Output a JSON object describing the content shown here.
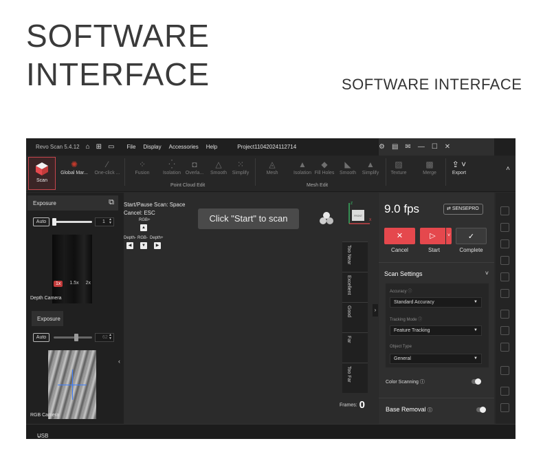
{
  "hero": {
    "title_line1": "SOFTWARE",
    "title_line2": "INTERFACE",
    "subtitle": "SOFTWARE INTERFACE"
  },
  "titlebar": {
    "app_name": "Revo Scan 5.4.12",
    "menu": [
      "File",
      "Display",
      "Accessories",
      "Help"
    ],
    "project": "Project11042024112714"
  },
  "toolbar": {
    "scan_label": "Scan",
    "buttons": [
      {
        "label": "Global Mar...",
        "icon": "global-marker-icon"
      },
      {
        "label": "One-click ...",
        "icon": "magic-wand-icon"
      },
      {
        "label": "Fusion",
        "icon": "fusion-icon"
      },
      {
        "label": "Isolation",
        "icon": "isolation-icon"
      },
      {
        "label": "Overla...",
        "icon": "overlap-icon"
      },
      {
        "label": "Smooth",
        "icon": "smooth-icon"
      },
      {
        "label": "Simplify",
        "icon": "simplify-icon"
      },
      {
        "label": "Mesh",
        "icon": "mesh-icon"
      },
      {
        "label": "Isolation",
        "icon": "isolation-icon"
      },
      {
        "label": "Fill Holes",
        "icon": "fill-holes-icon"
      },
      {
        "label": "Smooth",
        "icon": "smooth-icon"
      },
      {
        "label": "Simplify",
        "icon": "simplify-icon"
      },
      {
        "label": "Texture",
        "icon": "texture-icon"
      },
      {
        "label": "Merge",
        "icon": "merge-icon"
      },
      {
        "label": "Export",
        "icon": "export-icon"
      }
    ],
    "group_point_cloud": "Point Cloud Edit",
    "group_mesh": "Mesh Edit"
  },
  "left": {
    "depth_exposure": "Exposure",
    "depth_auto": "Auto",
    "depth_value": "1",
    "zoom": [
      "1x",
      "1.5x",
      "2x"
    ],
    "depth_camera_label": "Depth Camera",
    "rgb_exposure": "Exposure",
    "rgb_auto": "Auto",
    "rgb_value": "62",
    "rgb_camera_label": "RGB Camera"
  },
  "center": {
    "hint_start": "Start/Pause Scan:  Space",
    "hint_cancel": "Cancel:  ESC",
    "rgb_plus": "RGB+",
    "depth_minus": "Depth-",
    "rgb_minus": "RGB-",
    "depth_plus": "Depth+",
    "toast": "Click \"Start\" to scan",
    "axis_front": "FRONT",
    "quality": [
      "Too Near",
      "Excellent",
      "Good",
      "Far",
      "Too Far"
    ],
    "frames_label": "Frames:",
    "frames_value": "0"
  },
  "right": {
    "fps": "9.0 fps",
    "brand": "SENSEPRO",
    "cancel": "Cancel",
    "start": "Start",
    "complete": "Complete",
    "scan_settings": "Scan Settings",
    "accuracy_label": "Accuracy",
    "accuracy_value": "Standard Accuracy",
    "tracking_label": "Tracking Mode",
    "tracking_value": "Feature Tracking",
    "object_label": "Object Type",
    "object_value": "General",
    "color_scanning": "Color Scanning",
    "base_removal": "Base Removal"
  },
  "status": {
    "text": "USB Connected"
  },
  "colors": {
    "accent_red": "#e5484d",
    "panel_dark": "#2a2a2a"
  }
}
